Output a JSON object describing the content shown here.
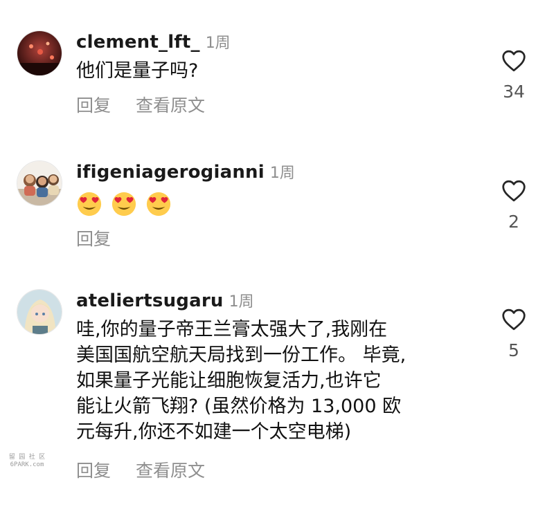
{
  "comments": [
    {
      "username": "clement_lft_",
      "time": "1周",
      "text": "他们是量子吗?",
      "actions": [
        "回复",
        "查看原文"
      ],
      "likes": "34"
    },
    {
      "username": "ifigeniagerogianni",
      "time": "1周",
      "emoji_count": 3,
      "actions": [
        "回复"
      ],
      "likes": "2"
    },
    {
      "username": "ateliertsugaru",
      "time": "1周",
      "text_lines": [
        "哇,你的量子帝王兰膏太强大了,我刚在",
        "美国国航空航天局找到一份工作。 毕竟,",
        "如果量子光能让细胞恢复活力,也许它",
        "能让火箭飞翔? (虽然价格为 13,000 欧",
        "元每升,你还不如建一个太空电梯)"
      ],
      "actions": [
        "回复",
        "查看原文"
      ],
      "likes": "5"
    }
  ],
  "watermark": {
    "line1": "留 园 社 区",
    "line2": "6PARK.com"
  },
  "colors": {
    "muted": "#8e8e8e",
    "text": "#111111",
    "username": "#1a1a1a"
  },
  "icons": {
    "like": "heart-outline-icon",
    "emoji": "heart-eyes-emoji"
  }
}
